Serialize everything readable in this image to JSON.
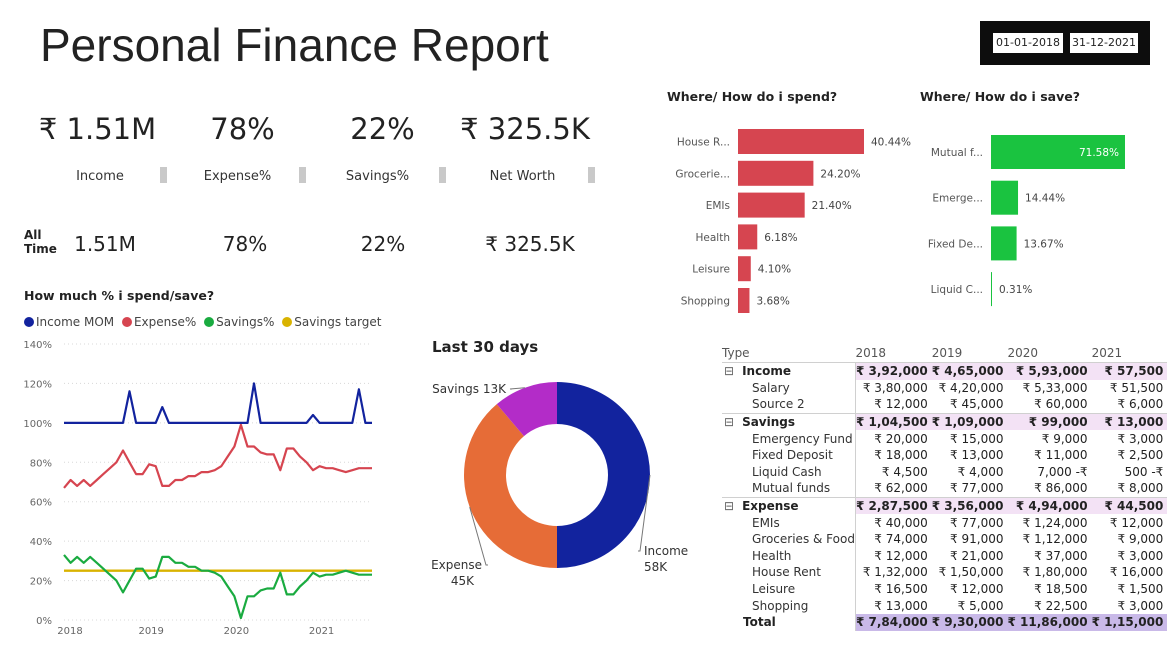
{
  "title": "Personal Finance Report",
  "date_filter": {
    "start": "01-01-2018",
    "end": "31-12-2021"
  },
  "kpis": [
    {
      "value": "₹ 1.51M",
      "label": "Income"
    },
    {
      "value": "78%",
      "label": "Expense%"
    },
    {
      "value": "22%",
      "label": "Savings%"
    },
    {
      "value": "₹ 325.5K",
      "label": "Net Worth"
    }
  ],
  "all_time": {
    "label_line1": "All",
    "label_line2": "Time",
    "values": [
      "1.51M",
      "78%",
      "22%",
      "₹ 325.5K"
    ]
  },
  "colors": {
    "income": "#12239e",
    "expense": "#d64550",
    "savings": "#1aab40",
    "target": "#d9b300",
    "spend_bar": "#d64550",
    "save_bar": "#1ac340",
    "donut_income": "#12239e",
    "donut_expense": "#e66c37",
    "donut_savings": "#b32cc8",
    "matrix_highlight": "#f3e2f5",
    "matrix_total": "#c9b9e8"
  },
  "chart_data": [
    {
      "type": "line",
      "title": "How much % i spend/save?",
      "legend_position": "top-left",
      "x_tick_labels": [
        "2018",
        "2019",
        "2020",
        "2021"
      ],
      "y_tick_labels": [
        "0%",
        "20%",
        "40%",
        "60%",
        "80%",
        "100%",
        "120%",
        "140%"
      ],
      "ylim": [
        0,
        140
      ],
      "grid": true,
      "x": [
        1,
        2,
        3,
        4,
        5,
        6,
        7,
        8,
        9,
        10,
        11,
        12,
        13,
        14,
        15,
        16,
        17,
        18,
        19,
        20,
        21,
        22,
        23,
        24,
        25,
        26,
        27,
        28,
        29,
        30,
        31,
        32,
        33,
        34,
        35,
        36,
        37,
        38,
        39,
        40,
        41,
        42,
        43,
        44,
        45,
        46,
        47,
        48
      ],
      "series": [
        {
          "name": "Income MOM",
          "values": [
            100,
            100,
            100,
            100,
            100,
            100,
            100,
            100,
            100,
            100,
            116,
            100,
            100,
            100,
            100,
            108,
            100,
            100,
            100,
            100,
            100,
            100,
            100,
            100,
            100,
            100,
            100,
            100,
            100,
            120,
            100,
            100,
            100,
            100,
            100,
            100,
            100,
            100,
            104,
            100,
            100,
            100,
            100,
            100,
            100,
            117,
            100,
            100
          ]
        },
        {
          "name": "Expense%",
          "values": [
            67,
            71,
            68,
            71,
            68,
            71,
            74,
            77,
            80,
            86,
            80,
            74,
            74,
            79,
            78,
            68,
            68,
            71,
            71,
            73,
            73,
            75,
            75,
            76,
            78,
            83,
            88,
            99,
            88,
            88,
            85,
            84,
            84,
            76,
            87,
            87,
            83,
            80,
            76,
            78,
            77,
            77,
            76,
            75,
            76,
            77,
            77,
            77
          ]
        },
        {
          "name": "Savings%",
          "values": [
            33,
            29,
            32,
            29,
            32,
            29,
            26,
            23,
            20,
            14,
            20,
            26,
            26,
            21,
            22,
            32,
            32,
            29,
            29,
            27,
            27,
            25,
            25,
            24,
            22,
            17,
            12,
            1,
            12,
            12,
            15,
            16,
            16,
            24,
            13,
            13,
            17,
            20,
            24,
            22,
            23,
            23,
            24,
            25,
            24,
            23,
            23,
            23
          ]
        },
        {
          "name": "Savings target",
          "values": [
            25,
            25,
            25,
            25,
            25,
            25,
            25,
            25,
            25,
            25,
            25,
            25,
            25,
            25,
            25,
            25,
            25,
            25,
            25,
            25,
            25,
            25,
            25,
            25,
            25,
            25,
            25,
            25,
            25,
            25,
            25,
            25,
            25,
            25,
            25,
            25,
            25,
            25,
            25,
            25,
            25,
            25,
            25,
            25,
            25,
            25,
            25,
            25
          ]
        }
      ]
    },
    {
      "type": "pie",
      "title": "Last 30 days",
      "slices": [
        {
          "name": "Income",
          "label_line1": "Income",
          "label_line2": "58K",
          "value": 58
        },
        {
          "name": "Expense",
          "label_line1": "Expense",
          "label_line2": "45K",
          "value": 45
        },
        {
          "name": "Savings",
          "label_line1": "Savings 13K",
          "label_line2": "",
          "value": 13
        }
      ]
    },
    {
      "type": "bar",
      "title": "Where/ How do i spend?",
      "categories": [
        "House R...",
        "Grocerie...",
        "EMIs",
        "Health",
        "Leisure",
        "Shopping"
      ],
      "values": [
        40.44,
        24.2,
        21.4,
        6.18,
        4.1,
        3.68
      ],
      "data_labels": [
        "40.44%",
        "24.20%",
        "21.40%",
        "6.18%",
        "4.10%",
        "3.68%"
      ]
    },
    {
      "type": "bar",
      "title": "Where/ How do i save?",
      "categories": [
        "Mutual f...",
        "Emerge...",
        "Fixed De...",
        "Liquid C..."
      ],
      "values": [
        71.58,
        14.44,
        13.67,
        0.31
      ],
      "data_labels": [
        "71.58%",
        "14.44%",
        "13.67%",
        "0.31%"
      ]
    },
    {
      "type": "table",
      "header": [
        "Type",
        "2018",
        "2019",
        "2020",
        "2021"
      ],
      "rows": [
        {
          "kind": "group",
          "expander": "⊟",
          "label": "Income",
          "cells": [
            "₹ 3,92,000",
            "₹ 4,65,000",
            "₹ 5,93,000",
            "₹ 57,500"
          ]
        },
        {
          "kind": "item",
          "label": "Salary",
          "cells": [
            "₹ 3,80,000",
            "₹ 4,20,000",
            "₹ 5,33,000",
            "₹ 51,500"
          ]
        },
        {
          "kind": "item",
          "label": "Source 2",
          "cells": [
            "₹ 12,000",
            "₹ 45,000",
            "₹ 60,000",
            "₹ 6,000"
          ]
        },
        {
          "kind": "group",
          "expander": "⊟",
          "label": "Savings",
          "cells": [
            "₹ 1,04,500",
            "₹ 1,09,000",
            "₹ 99,000",
            "₹ 13,000"
          ]
        },
        {
          "kind": "item",
          "label": "Emergency Fund",
          "cells": [
            "₹ 20,000",
            "₹ 15,000",
            "₹ 9,000",
            "₹ 3,000"
          ]
        },
        {
          "kind": "item",
          "label": "Fixed Deposit",
          "cells": [
            "₹ 18,000",
            "₹ 13,000",
            "₹ 11,000",
            "₹ 2,500"
          ]
        },
        {
          "kind": "item",
          "label": "Liquid Cash",
          "cells": [
            "₹ 4,500",
            "₹ 4,000",
            "7,000 -₹",
            "500 -₹"
          ]
        },
        {
          "kind": "item",
          "label": "Mutual funds",
          "cells": [
            "₹ 62,000",
            "₹ 77,000",
            "₹ 86,000",
            "₹ 8,000"
          ]
        },
        {
          "kind": "group",
          "expander": "⊟",
          "label": "Expense",
          "cells": [
            "₹ 2,87,500",
            "₹ 3,56,000",
            "₹ 4,94,000",
            "₹ 44,500"
          ]
        },
        {
          "kind": "item",
          "label": "EMIs",
          "cells": [
            "₹ 40,000",
            "₹ 77,000",
            "₹ 1,24,000",
            "₹ 12,000"
          ]
        },
        {
          "kind": "item",
          "label": "Groceries & Food",
          "cells": [
            "₹ 74,000",
            "₹ 91,000",
            "₹ 1,12,000",
            "₹ 9,000"
          ]
        },
        {
          "kind": "item",
          "label": "Health",
          "cells": [
            "₹ 12,000",
            "₹ 21,000",
            "₹ 37,000",
            "₹ 3,000"
          ]
        },
        {
          "kind": "item",
          "label": "House Rent",
          "cells": [
            "₹ 1,32,000",
            "₹ 1,50,000",
            "₹ 1,80,000",
            "₹ 16,000"
          ]
        },
        {
          "kind": "item",
          "label": "Leisure",
          "cells": [
            "₹ 16,500",
            "₹ 12,000",
            "₹ 18,500",
            "₹ 1,500"
          ]
        },
        {
          "kind": "item",
          "label": "Shopping",
          "cells": [
            "₹ 13,000",
            "₹ 5,000",
            "₹ 22,500",
            "₹ 3,000"
          ]
        },
        {
          "kind": "total",
          "label": "Total",
          "cells": [
            "₹ 7,84,000",
            "₹ 9,30,000",
            "₹ 11,86,000",
            "₹ 1,15,000"
          ]
        }
      ]
    }
  ]
}
